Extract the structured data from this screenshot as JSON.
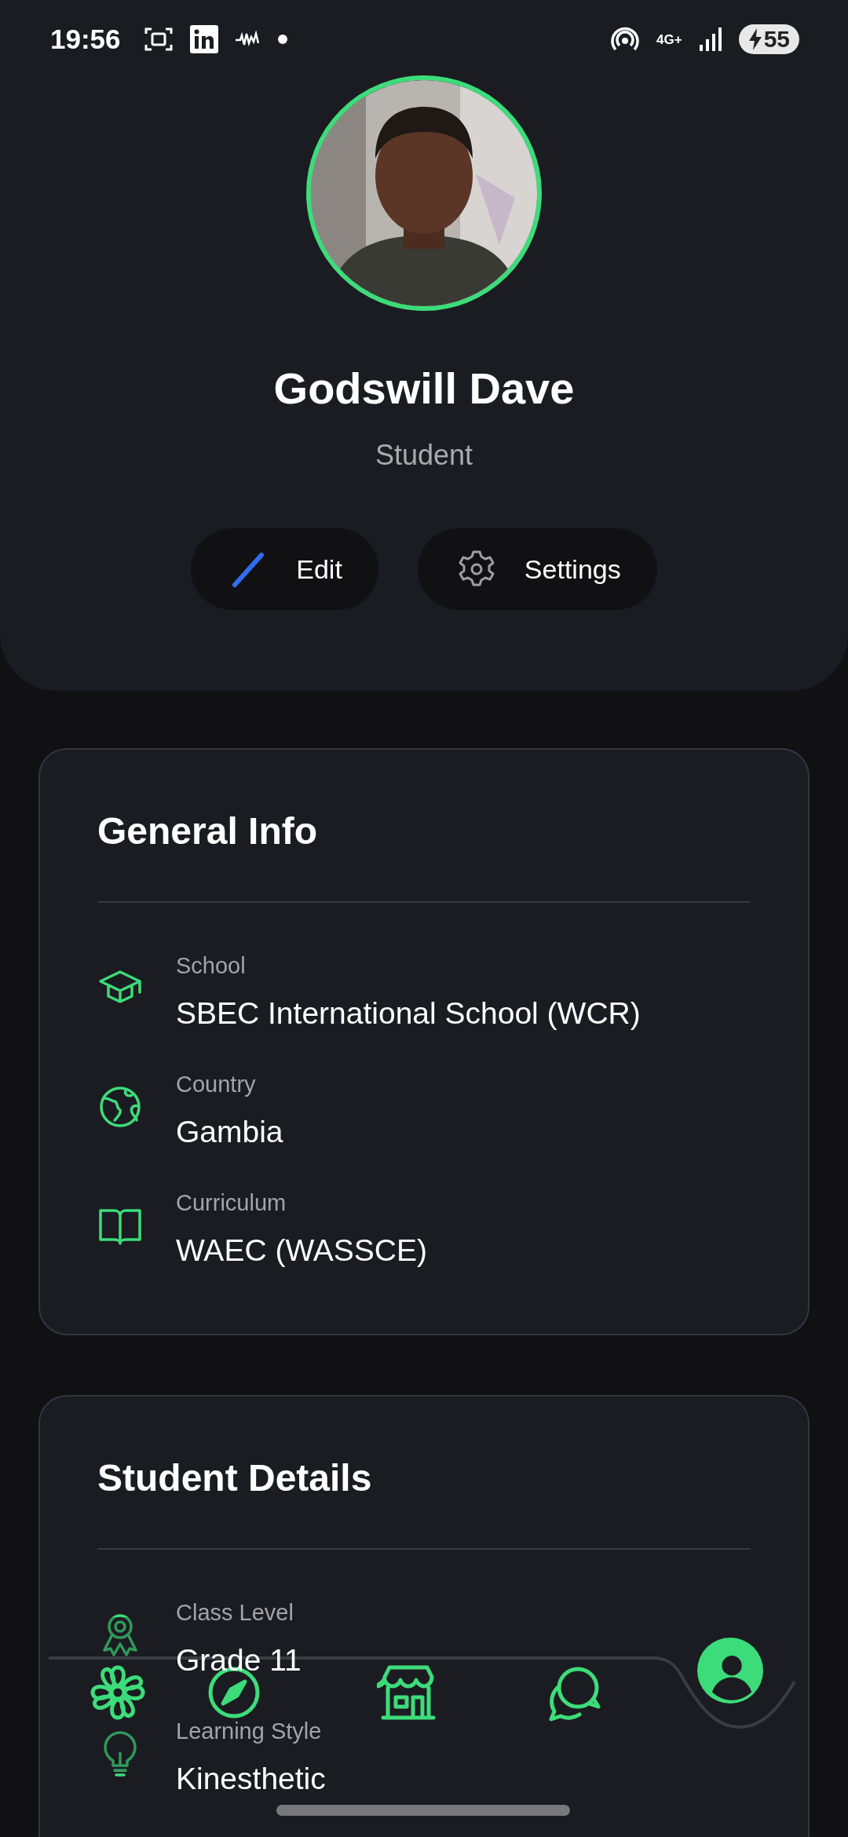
{
  "status_bar": {
    "time": "19:56",
    "network": "4G+",
    "battery": "55"
  },
  "profile": {
    "name": "Godswill Dave",
    "role": "Student"
  },
  "actions": [
    {
      "kind": "edit",
      "label": "Edit"
    },
    {
      "kind": "settings",
      "label": "Settings"
    }
  ],
  "cards": [
    {
      "title": "General Info",
      "rows": [
        {
          "kind": "cap",
          "label": "School",
          "value": "SBEC International School (WCR)"
        },
        {
          "kind": "globe",
          "label": "Country",
          "value": "Gambia"
        },
        {
          "kind": "book",
          "label": "Curriculum",
          "value": "WAEC (WASSCE)"
        }
      ]
    },
    {
      "title": "Student Details",
      "rows": [
        {
          "kind": "award",
          "label": "Class Level",
          "value": "Grade 11"
        },
        {
          "kind": "bulb",
          "label": "Learning Style",
          "value": "Kinesthetic"
        }
      ]
    }
  ],
  "bottom_nav": [
    {
      "kind": "flower",
      "selected": false
    },
    {
      "kind": "compass",
      "selected": false
    },
    {
      "kind": "store",
      "selected": false
    },
    {
      "kind": "chat",
      "selected": false
    },
    {
      "kind": "user",
      "selected": true
    }
  ]
}
